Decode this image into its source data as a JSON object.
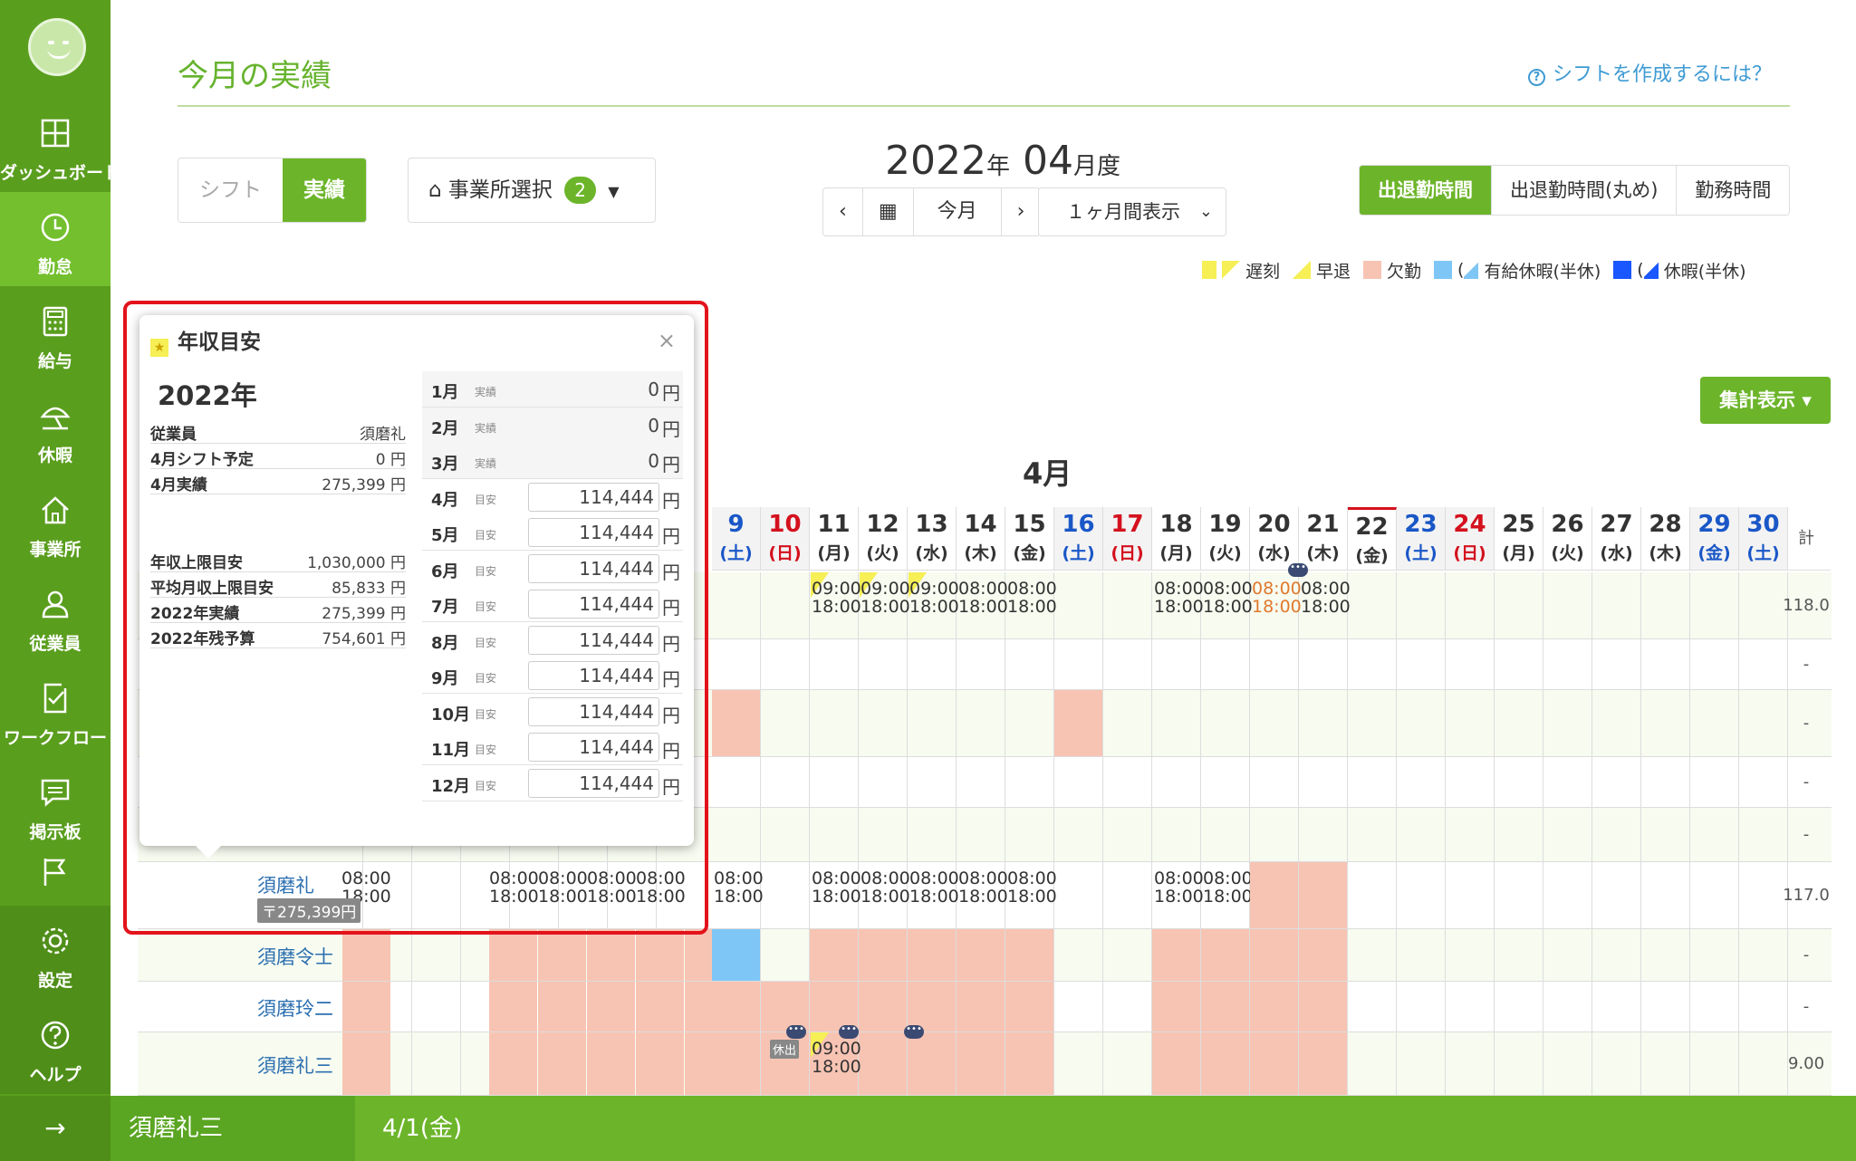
{
  "sidebar": {
    "items": [
      {
        "label": "ダッシュボード",
        "icon": "dashboard-icon"
      },
      {
        "label": "勤怠",
        "icon": "clock-icon"
      },
      {
        "label": "給与",
        "icon": "calculator-icon"
      },
      {
        "label": "休暇",
        "icon": "umbrella-icon"
      },
      {
        "label": "事業所",
        "icon": "home-icon"
      },
      {
        "label": "従業員",
        "icon": "person-icon"
      },
      {
        "label": "ワークフロー",
        "icon": "checklist-icon"
      },
      {
        "label": "掲示板",
        "icon": "message-icon"
      },
      {
        "label": "",
        "icon": "flag-icon"
      },
      {
        "label": "設定",
        "icon": "gear-icon"
      },
      {
        "label": "ヘルプ",
        "icon": "help-icon"
      }
    ],
    "collapse": "→"
  },
  "page": {
    "title": "今月の実績",
    "help_link": "シフトを作成するには？"
  },
  "toggle": {
    "shift": "シフト",
    "actual": "実績"
  },
  "office": {
    "label": "事業所選択",
    "count": "2"
  },
  "period": {
    "year": "2022",
    "year_unit": "年",
    "month": "04",
    "month_unit": "月度"
  },
  "nav": {
    "prev": "‹",
    "calendar": "▦",
    "today": "今月",
    "next": "›",
    "range": "１ヶ月間表示"
  },
  "display_modes": [
    "出退勤時間",
    "出退勤時間(丸め)",
    "勤務時間"
  ],
  "legend": {
    "late": "遅刻",
    "early": "早退",
    "absent": "欠勤",
    "paid": "有給休暇(半休)",
    "leave": "休暇(半休)",
    "paren": "(",
    "colors": {
      "late": "#f6ef55",
      "absent": "#f7c4b3",
      "paid": "#7ec6f5",
      "leave": "#1a57ff"
    }
  },
  "summary_button": "集計表示 ▾",
  "calendar": {
    "month_label": "4月",
    "total_label": "計",
    "days": [
      {
        "n": "9",
        "w": "(土)",
        "t": "sat"
      },
      {
        "n": "10",
        "w": "(日)",
        "t": "sun"
      },
      {
        "n": "11",
        "w": "(月)",
        "t": ""
      },
      {
        "n": "12",
        "w": "(火)",
        "t": ""
      },
      {
        "n": "13",
        "w": "(水)",
        "t": ""
      },
      {
        "n": "14",
        "w": "(木)",
        "t": ""
      },
      {
        "n": "15",
        "w": "(金)",
        "t": ""
      },
      {
        "n": "16",
        "w": "(土)",
        "t": "sat"
      },
      {
        "n": "17",
        "w": "(日)",
        "t": "sun"
      },
      {
        "n": "18",
        "w": "(月)",
        "t": ""
      },
      {
        "n": "19",
        "w": "(火)",
        "t": ""
      },
      {
        "n": "20",
        "w": "(水)",
        "t": ""
      },
      {
        "n": "21",
        "w": "(木)",
        "t": ""
      },
      {
        "n": "22",
        "w": "(金)",
        "t": "today"
      },
      {
        "n": "23",
        "w": "(土)",
        "t": "sat"
      },
      {
        "n": "24",
        "w": "(日)",
        "t": "sun"
      },
      {
        "n": "25",
        "w": "(月)",
        "t": ""
      },
      {
        "n": "26",
        "w": "(火)",
        "t": ""
      },
      {
        "n": "27",
        "w": "(水)",
        "t": ""
      },
      {
        "n": "28",
        "w": "(木)",
        "t": ""
      },
      {
        "n": "29",
        "w": "(金)",
        "t": "sat"
      },
      {
        "n": "30",
        "w": "(土)",
        "t": "sat"
      }
    ],
    "times": {
      "in": "08:00",
      "out": "18:00",
      "late_in": "09:00",
      "dash": "-"
    },
    "rows": [
      {
        "name": "",
        "total": "118.0"
      },
      {
        "name": "",
        "total": "-"
      },
      {
        "name": "",
        "total": "-"
      },
      {
        "name": "",
        "total": "-"
      },
      {
        "name": "",
        "total": "-"
      },
      {
        "name": "須磨礼",
        "total": "117.0",
        "estimate": "〒275,399円"
      },
      {
        "name": "須磨令士",
        "total": "-"
      },
      {
        "name": "須磨玲二",
        "total": "-"
      },
      {
        "name": "須磨礼三",
        "total": "9.00",
        "tag": "休出"
      }
    ]
  },
  "popup": {
    "title": "年収目安",
    "close": "×",
    "year": "2022年",
    "info": [
      {
        "k": "従業員",
        "v": "須磨礼"
      },
      {
        "k": "4月シフト予定",
        "v": "0 円"
      },
      {
        "k": "4月実績",
        "v": "275,399 円"
      },
      {
        "k": "年収上限目安",
        "v": "1,030,000 円"
      },
      {
        "k": "平均月収上限目安",
        "v": "85,833 円"
      },
      {
        "k": "2022年実績",
        "v": "275,399 円"
      },
      {
        "k": "2022年残予算",
        "v": "754,601 円"
      }
    ],
    "months": [
      {
        "m": "1月",
        "s": "実績",
        "v": "0",
        "est": false
      },
      {
        "m": "2月",
        "s": "実績",
        "v": "0",
        "est": false
      },
      {
        "m": "3月",
        "s": "実績",
        "v": "0",
        "est": false
      },
      {
        "m": "4月",
        "s": "目安",
        "v": "114,444",
        "est": true
      },
      {
        "m": "5月",
        "s": "目安",
        "v": "114,444",
        "est": true
      },
      {
        "m": "6月",
        "s": "目安",
        "v": "114,444",
        "est": true
      },
      {
        "m": "7月",
        "s": "目安",
        "v": "114,444",
        "est": true
      },
      {
        "m": "8月",
        "s": "目安",
        "v": "114,444",
        "est": true
      },
      {
        "m": "9月",
        "s": "目安",
        "v": "114,444",
        "est": true
      },
      {
        "m": "10月",
        "s": "目安",
        "v": "114,444",
        "est": true
      },
      {
        "m": "11月",
        "s": "目安",
        "v": "114,444",
        "est": true
      },
      {
        "m": "12月",
        "s": "目安",
        "v": "114,444",
        "est": true
      }
    ],
    "yen": "円"
  },
  "footer": {
    "name": "須磨礼三",
    "date": "4/1(金)"
  }
}
